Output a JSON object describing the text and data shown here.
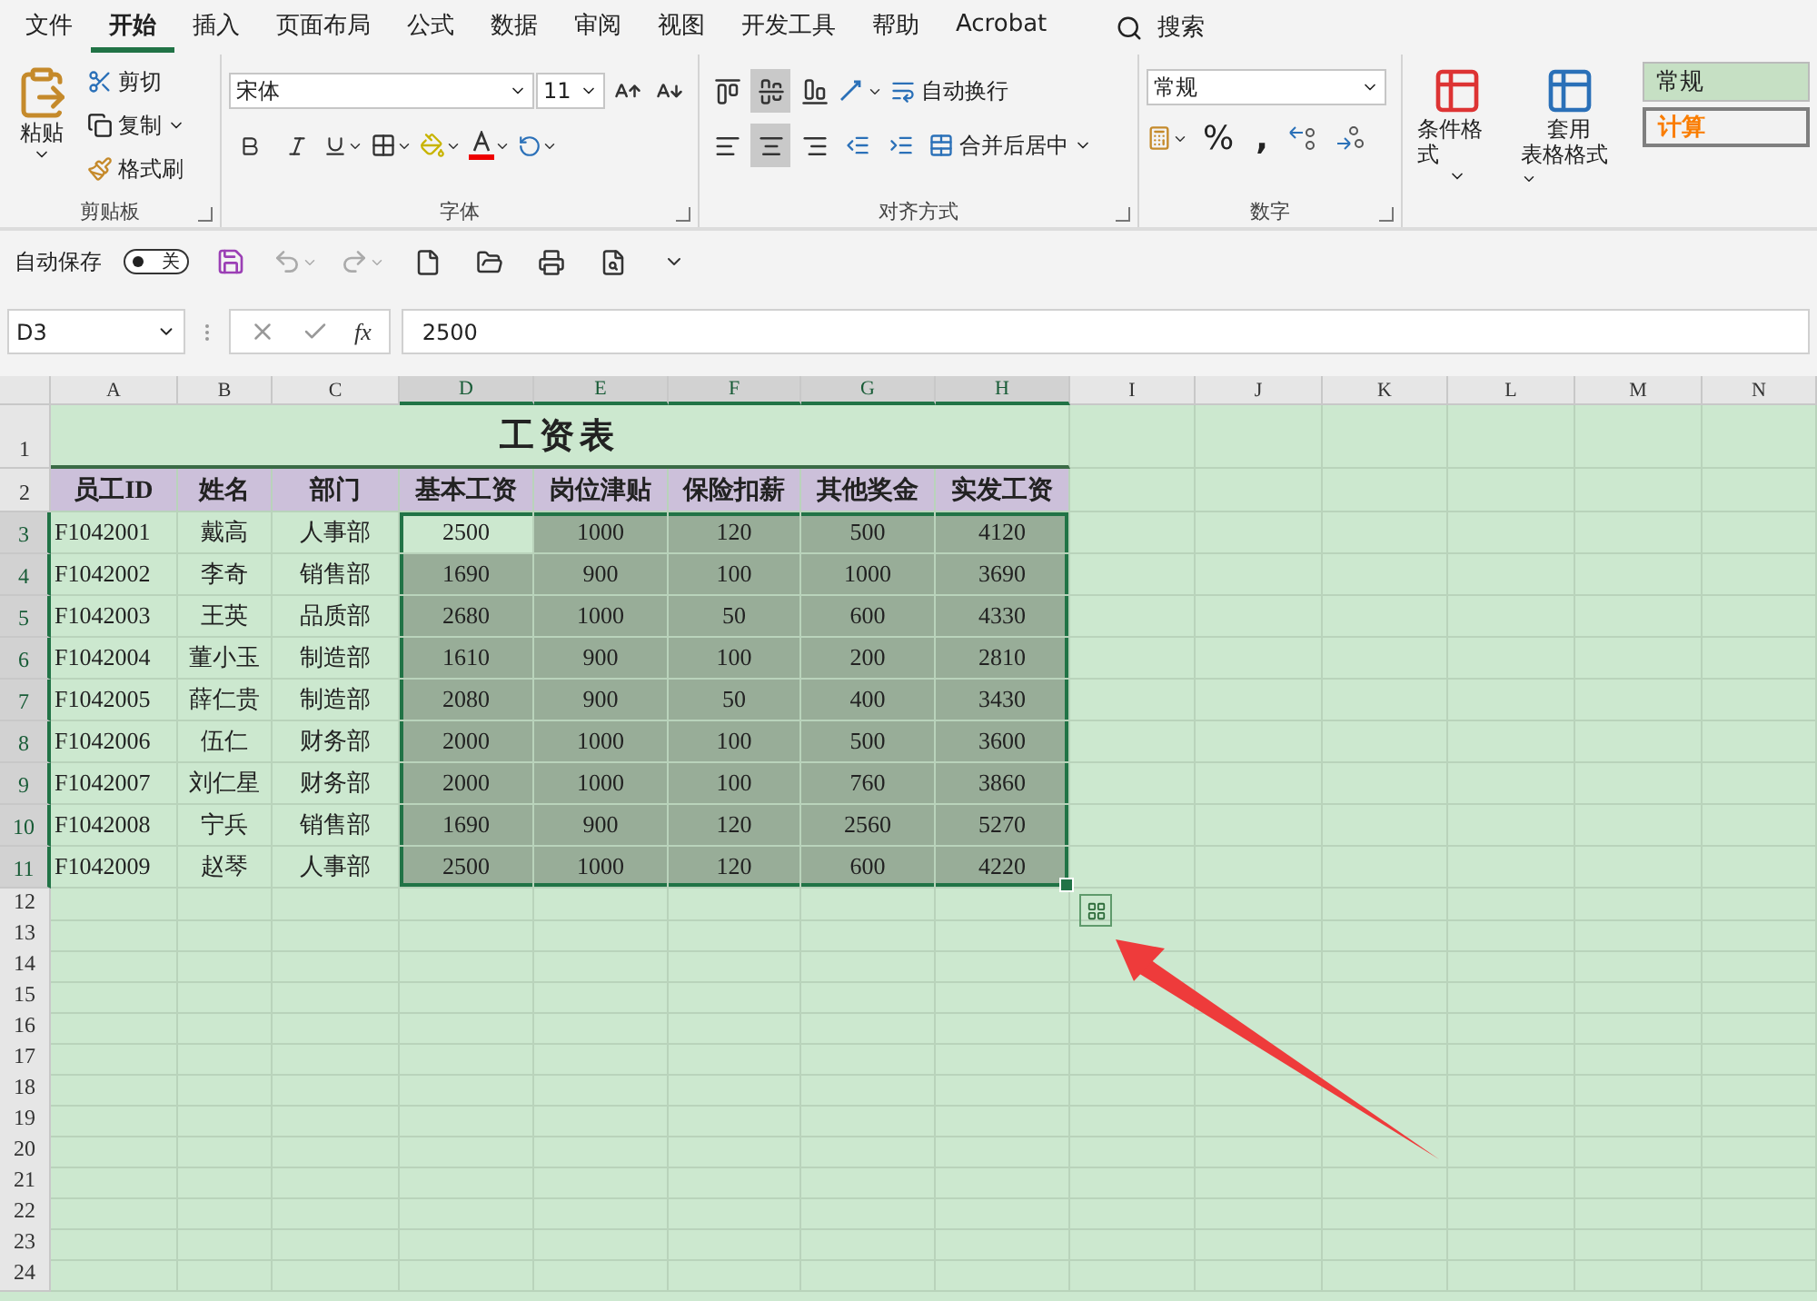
{
  "menu_tabs": [
    {
      "label": "文件",
      "selected": false
    },
    {
      "label": "开始",
      "selected": true
    },
    {
      "label": "插入",
      "selected": false
    },
    {
      "label": "页面布局",
      "selected": false
    },
    {
      "label": "公式",
      "selected": false
    },
    {
      "label": "数据",
      "selected": false
    },
    {
      "label": "审阅",
      "selected": false
    },
    {
      "label": "视图",
      "selected": false
    },
    {
      "label": "开发工具",
      "selected": false
    },
    {
      "label": "帮助",
      "selected": false
    },
    {
      "label": "Acrobat",
      "selected": false
    }
  ],
  "search": {
    "label": "搜索"
  },
  "ribbon": {
    "clipboard": {
      "paste": "粘贴",
      "cut": "剪切",
      "copy": "复制",
      "format_painter": "格式刷",
      "label": "剪贴板"
    },
    "font": {
      "font_name": "宋体",
      "font_size": "11",
      "label": "字体"
    },
    "alignment": {
      "vertical": [
        {
          "kind": "top",
          "selected": false
        },
        {
          "kind": "middle",
          "selected": true
        },
        {
          "kind": "bottom",
          "selected": false
        }
      ],
      "horizontal": [
        {
          "kind": "left",
          "selected": false
        },
        {
          "kind": "center",
          "selected": true
        },
        {
          "kind": "right",
          "selected": false
        }
      ],
      "wrap_text": "自动换行",
      "merge_center": "合并后居中",
      "label": "对齐方式"
    },
    "number": {
      "format": "常规",
      "percent": "%",
      "comma": ",",
      "label": "数字"
    },
    "styles": {
      "conditional_format": "条件格式",
      "table_format": [
        "套用",
        "表格格式"
      ],
      "cell_styles": [
        {
          "kind": "normal",
          "label": "常规"
        },
        {
          "kind": "calculation",
          "label": "计算"
        }
      ]
    }
  },
  "quick_access": {
    "autosave_label": "自动保存",
    "autosave": {
      "label": "关",
      "on": false
    }
  },
  "formula_bar": {
    "name_box": "D3",
    "fx": "fx",
    "formula": "2500"
  },
  "sheet": {
    "columns": [
      {
        "label": "A",
        "selected": false
      },
      {
        "label": "B",
        "selected": false
      },
      {
        "label": "C",
        "selected": false
      },
      {
        "label": "D",
        "selected": true
      },
      {
        "label": "E",
        "selected": true
      },
      {
        "label": "F",
        "selected": true
      },
      {
        "label": "G",
        "selected": true
      },
      {
        "label": "H",
        "selected": true
      },
      {
        "label": "I",
        "selected": false
      },
      {
        "label": "J",
        "selected": false
      },
      {
        "label": "K",
        "selected": false
      },
      {
        "label": "L",
        "selected": false
      },
      {
        "label": "M",
        "selected": false
      },
      {
        "label": "N",
        "selected": false
      }
    ],
    "rows": [
      {
        "kind": "title",
        "number": "1",
        "selected": false,
        "title": "工资表"
      },
      {
        "kind": "header",
        "number": "2",
        "selected": false,
        "cells": [
          "员工ID",
          "姓名",
          "部门",
          "基本工资",
          "岗位津贴",
          "保险扣薪",
          "其他奖金",
          "实发工资"
        ]
      },
      {
        "kind": "data",
        "number": "3",
        "selected": true,
        "cells": [
          "F1042001",
          "戴高",
          "人事部",
          "2500",
          "1000",
          "120",
          "500",
          "4120"
        ]
      },
      {
        "kind": "data",
        "number": "4",
        "selected": true,
        "cells": [
          "F1042002",
          "李奇",
          "销售部",
          "1690",
          "900",
          "100",
          "1000",
          "3690"
        ]
      },
      {
        "kind": "data",
        "number": "5",
        "selected": true,
        "cells": [
          "F1042003",
          "王英",
          "品质部",
          "2680",
          "1000",
          "50",
          "600",
          "4330"
        ]
      },
      {
        "kind": "data",
        "number": "6",
        "selected": true,
        "cells": [
          "F1042004",
          "董小玉",
          "制造部",
          "1610",
          "900",
          "100",
          "200",
          "2810"
        ]
      },
      {
        "kind": "data",
        "number": "7",
        "selected": true,
        "cells": [
          "F1042005",
          "薛仁贵",
          "制造部",
          "2080",
          "900",
          "50",
          "400",
          "3430"
        ]
      },
      {
        "kind": "data",
        "number": "8",
        "selected": true,
        "cells": [
          "F1042006",
          "伍仁",
          "财务部",
          "2000",
          "1000",
          "100",
          "500",
          "3600"
        ]
      },
      {
        "kind": "data",
        "number": "9",
        "selected": true,
        "cells": [
          "F1042007",
          "刘仁星",
          "财务部",
          "2000",
          "1000",
          "100",
          "760",
          "3860"
        ]
      },
      {
        "kind": "data",
        "number": "10",
        "selected": true,
        "cells": [
          "F1042008",
          "宁兵",
          "销售部",
          "1690",
          "900",
          "120",
          "2560",
          "5270"
        ]
      },
      {
        "kind": "data",
        "number": "11",
        "selected": true,
        "cells": [
          "F1042009",
          "赵琴",
          "人事部",
          "2500",
          "1000",
          "120",
          "600",
          "4220"
        ]
      },
      {
        "kind": "empty",
        "number": "12",
        "selected": false
      },
      {
        "kind": "empty",
        "number": "13",
        "selected": false
      },
      {
        "kind": "empty",
        "number": "14",
        "selected": false
      },
      {
        "kind": "empty",
        "number": "15",
        "selected": false
      },
      {
        "kind": "empty",
        "number": "16",
        "selected": false
      },
      {
        "kind": "empty",
        "number": "17",
        "selected": false
      },
      {
        "kind": "empty",
        "number": "18",
        "selected": false
      },
      {
        "kind": "empty",
        "number": "19",
        "selected": false
      },
      {
        "kind": "empty",
        "number": "20",
        "selected": false
      },
      {
        "kind": "empty",
        "number": "21",
        "selected": false
      },
      {
        "kind": "empty",
        "number": "22",
        "selected": false
      },
      {
        "kind": "empty",
        "number": "23",
        "selected": false
      },
      {
        "kind": "empty",
        "number": "24",
        "selected": false
      }
    ]
  }
}
